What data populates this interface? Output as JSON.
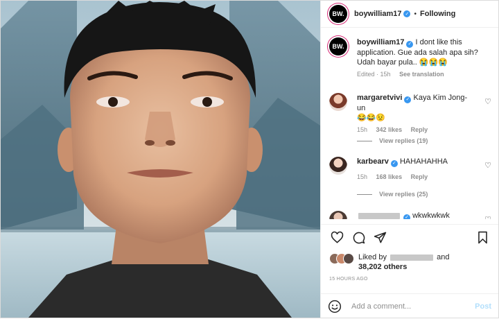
{
  "header": {
    "avatar_text": "BW.",
    "username": "boywilliam17",
    "separator": "•",
    "following_label": "Following",
    "more_label": "•••"
  },
  "caption": {
    "avatar_text": "BW.",
    "username": "boywilliam17",
    "text": "I dont like this application. Gue ada salah apa sih? Udah bayar pula..",
    "emojis": "😭😭😭",
    "edited": "Edited · 15h",
    "see_translation": "See translation"
  },
  "comments": [
    {
      "username": "margaretvivi",
      "text": "Kaya Kim Jong-un",
      "emojis": "😂😂😟",
      "time": "15h",
      "likes": "342 likes",
      "reply_label": "Reply",
      "view_replies": "View replies (19)"
    },
    {
      "username": "karbearv",
      "text": "HAHAHAHHA",
      "time": "15h",
      "likes": "168 likes",
      "reply_label": "Reply",
      "view_replies": "View replies (25)"
    },
    {
      "text": "wkwkwkwk"
    }
  ],
  "likes": {
    "prefix": "Liked by",
    "and": "and",
    "others": "38,202 others"
  },
  "timestamp": "15 HOURS AGO",
  "add_comment": {
    "placeholder": "Add a comment...",
    "post_label": "Post"
  },
  "icons": {
    "heart": "heart-icon",
    "comment": "comment-icon",
    "share": "share-icon",
    "save": "bookmark-icon",
    "emoji": "emoji-icon",
    "verified": "verified-badge-icon"
  },
  "colors": {
    "verified_blue": "#3897f0",
    "post_button_disabled": "#b2dffc",
    "muted_text": "#8e8e8e"
  }
}
